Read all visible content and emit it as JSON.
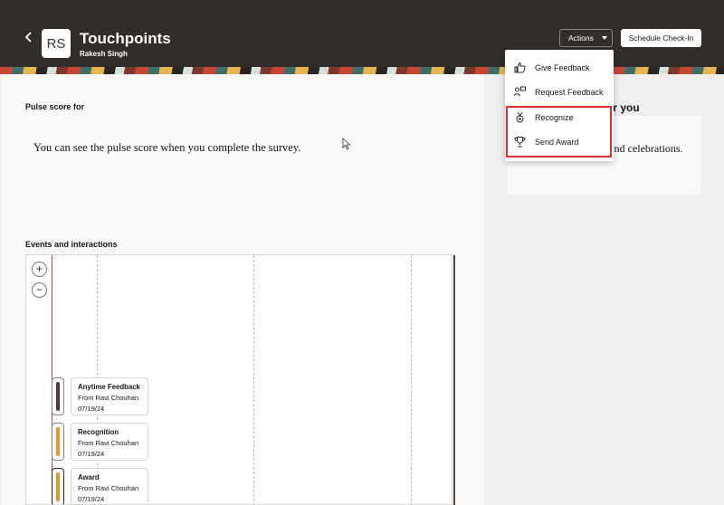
{
  "header": {
    "avatar_initials": "RS",
    "title": "Touchpoints",
    "subtitle": "Rakesh Singh",
    "actions_label": "Actions",
    "schedule_label": "Schedule Check-In"
  },
  "pulse": {
    "label": "Pulse score for",
    "message": "You can see the pulse score when you complete the survey."
  },
  "right_panel": {
    "heading_visible": "or you",
    "text_visible": "check-ins, feedback, and celebrations."
  },
  "actions_menu": {
    "items": [
      {
        "label": "Give Feedback",
        "icon": "thumbs-up-icon"
      },
      {
        "label": "Request Feedback",
        "icon": "request-feedback-icon"
      },
      {
        "label": "Recognize",
        "icon": "medal-icon"
      },
      {
        "label": "Send Award",
        "icon": "trophy-icon"
      }
    ]
  },
  "events": {
    "label": "Events and interactions",
    "zoom_in": "+",
    "zoom_out": "−",
    "items": [
      {
        "title": "Anytime Feedback",
        "from": "From Ravi Chouhan",
        "date": "07/19/24",
        "color": "#4a3a36"
      },
      {
        "title": "Recognition",
        "from": "From Ravi Chouhan",
        "date": "07/19/24",
        "color": "#e0972f"
      },
      {
        "title": "Award",
        "from": "From Ravi Chouhan",
        "date": "07/19/24",
        "color": "#e0972f"
      }
    ]
  },
  "colors": {
    "header_bg": "#312d2a",
    "highlight_border": "#d9302c",
    "timeline_axis": "#c74634"
  }
}
